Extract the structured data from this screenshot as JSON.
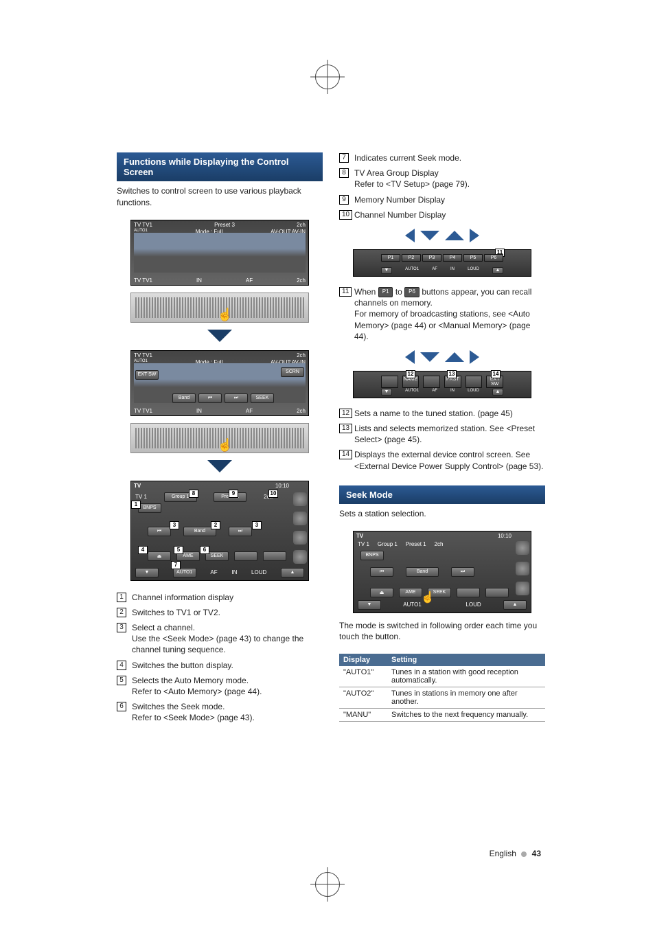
{
  "left": {
    "header": "Functions while Displaying the Control Screen",
    "desc": "Switches to control screen to use various playback functions.",
    "screen1": {
      "tl": "TV TV1",
      "sub": "AUTO1",
      "mid": "Preset 3",
      "mode": "Mode : Full",
      "av": "AV-OUT:AV-IN",
      "ch": "2ch",
      "bl": "TV    TV1",
      "in": "IN",
      "af": "AF"
    },
    "screen2": {
      "tl": "TV TV1",
      "sub": "AUTO1",
      "mode": "Mode : Full",
      "av": "AV-OUT:AV-IN",
      "scrn": "SCRN",
      "ch": "2ch",
      "ext": "EXT SW",
      "band": "Band",
      "seek": "SEEK",
      "bl": "TV    TV1",
      "in": "IN",
      "af": "AF",
      "ch2": "2ch"
    },
    "screen3": {
      "title": "TV",
      "tv1": "TV 1",
      "group": "Group 1",
      "preset": "Preset 1",
      "ch": "2ch",
      "time": "10:10",
      "bnps": "BNPS",
      "band": "Band",
      "ame": "AME",
      "seek": "SEEK",
      "auto": "AUTO1",
      "af_lab": "AF",
      "in_lab": "IN",
      "loud": "LOUD"
    },
    "items": [
      {
        "num": "1",
        "text": "Channel information display"
      },
      {
        "num": "2",
        "text": "Switches to TV1 or TV2."
      },
      {
        "num": "3",
        "text": "Select a channel.",
        "sub": "Use the <Seek Mode> (page 43) to change the channel tuning sequence."
      },
      {
        "num": "4",
        "text": "Switches the button display."
      },
      {
        "num": "5",
        "text": "Selects the Auto Memory mode.",
        "sub": "Refer to <Auto Memory> (page 44)."
      },
      {
        "num": "6",
        "text": "Switches the Seek mode.",
        "sub": "Refer to <Seek Mode> (page 43)."
      }
    ]
  },
  "right": {
    "items1": [
      {
        "num": "7",
        "text": "Indicates current Seek mode."
      },
      {
        "num": "8",
        "text": "TV Area Group Display",
        "sub": "Refer to <TV Setup> (page 79)."
      },
      {
        "num": "9",
        "text": "Memory Number Display"
      },
      {
        "num": "10",
        "text": "Channel Number Display"
      }
    ],
    "preset_strip": {
      "p": [
        "P1",
        "P2",
        "P3",
        "P4",
        "P5",
        "P6"
      ],
      "auto": "AUTO1",
      "af": "AF",
      "in": "IN",
      "loud": "LOUD"
    },
    "item11": {
      "num": "11",
      "pre": "When ",
      "p1": "P1",
      "mid": " to ",
      "p6": "P6",
      "post": " buttons appear, you can recall channels on memory.",
      "sub": "For memory of broadcasting stations, see <Auto Memory> (page 44) or <Manual Memory> (page 44)."
    },
    "strip2": {
      "name": "NAME",
      "prst": "PRST",
      "ext": "EXT SW",
      "auto": "AUTO1",
      "af": "AF",
      "in": "IN",
      "loud": "LOUD"
    },
    "items2": [
      {
        "num": "12",
        "text": "Sets a name to the tuned station. (page 45)"
      },
      {
        "num": "13",
        "text": "Lists and selects memorized station. See <Preset Select> (page 45)."
      },
      {
        "num": "14",
        "text": "Displays the external device control screen. See <External Device Power Supply Control> (page 53)."
      }
    ],
    "seek_header": "Seek Mode",
    "seek_desc": "Sets a station selection.",
    "seek_screen": {
      "title": "TV",
      "tv1": "TV 1",
      "group": "Group 1",
      "preset": "Preset 1",
      "ch": "2ch",
      "time": "10:10",
      "bnps": "BNPS",
      "band": "Band",
      "ame": "AME",
      "seek": "SEEK",
      "auto": "AUTO1",
      "loud": "LOUD"
    },
    "seek_note": "The mode is switched in following order each time you touch the button.",
    "table": {
      "h1": "Display",
      "h2": "Setting",
      "rows": [
        {
          "d": "\"AUTO1\"",
          "s": "Tunes in a station with good reception automatically."
        },
        {
          "d": "\"AUTO2\"",
          "s": "Tunes in stations in memory one after another."
        },
        {
          "d": "\"MANU\"",
          "s": "Switches to the next frequency manually."
        }
      ]
    }
  },
  "footer": {
    "lang": "English",
    "page": "43"
  }
}
